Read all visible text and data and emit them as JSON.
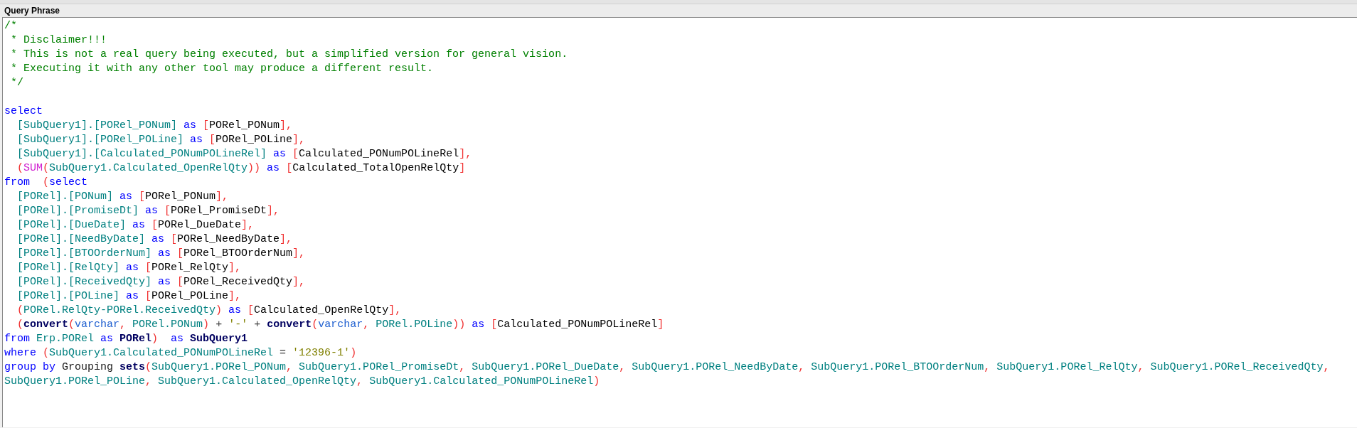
{
  "panel": {
    "title": "Query Phrase"
  },
  "comment_lines": [
    {
      "tokens": [
        {
          "kind": "comment",
          "text": "/*"
        }
      ]
    },
    {
      "tokens": [
        {
          "kind": "comment",
          "text": " * Disclaimer!!!"
        }
      ]
    },
    {
      "tokens": [
        {
          "kind": "comment",
          "text": " * This is not a real query being executed, but a simplified version for general vision."
        }
      ]
    },
    {
      "tokens": [
        {
          "kind": "comment",
          "text": " * Executing it with any other tool may produce a different result."
        }
      ]
    },
    {
      "tokens": [
        {
          "kind": "comment",
          "text": " */"
        }
      ]
    }
  ],
  "code_lines": [
    {
      "tokens": [
        {
          "kind": "keyword",
          "text": "select"
        }
      ]
    },
    {
      "tokens": [
        {
          "kind": "ident",
          "text": "  [SubQuery1].[PORel_PONum]"
        },
        {
          "kind": "keyword",
          "text": " as "
        },
        {
          "kind": "punct",
          "text": "["
        },
        {
          "kind": "alias",
          "text": "PORel_PONum"
        },
        {
          "kind": "punct",
          "text": "],"
        }
      ]
    },
    {
      "tokens": [
        {
          "kind": "ident",
          "text": "  [SubQuery1].[PORel_POLine]"
        },
        {
          "kind": "keyword",
          "text": " as "
        },
        {
          "kind": "punct",
          "text": "["
        },
        {
          "kind": "alias",
          "text": "PORel_POLine"
        },
        {
          "kind": "punct",
          "text": "],"
        }
      ]
    },
    {
      "tokens": [
        {
          "kind": "ident",
          "text": "  [SubQuery1].[Calculated_PONumPOLineRel]"
        },
        {
          "kind": "keyword",
          "text": " as "
        },
        {
          "kind": "punct",
          "text": "["
        },
        {
          "kind": "alias",
          "text": "Calculated_PONumPOLineRel"
        },
        {
          "kind": "punct",
          "text": "],"
        }
      ]
    },
    {
      "tokens": [
        {
          "kind": "punct",
          "text": "  ("
        },
        {
          "kind": "func",
          "text": "SUM"
        },
        {
          "kind": "punct",
          "text": "("
        },
        {
          "kind": "ident",
          "text": "SubQuery1.Calculated_OpenRelQty"
        },
        {
          "kind": "punct",
          "text": "))"
        },
        {
          "kind": "keyword",
          "text": " as "
        },
        {
          "kind": "punct",
          "text": "["
        },
        {
          "kind": "alias",
          "text": "Calculated_TotalOpenRelQty"
        },
        {
          "kind": "punct",
          "text": "]"
        }
      ]
    },
    {
      "tokens": [
        {
          "kind": "keyword",
          "text": "from"
        },
        {
          "kind": "punct",
          "text": "  ("
        },
        {
          "kind": "keyword",
          "text": "select"
        }
      ]
    },
    {
      "tokens": [
        {
          "kind": "ident",
          "text": "  [PORel].[PONum]"
        },
        {
          "kind": "keyword",
          "text": " as "
        },
        {
          "kind": "punct",
          "text": "["
        },
        {
          "kind": "alias",
          "text": "PORel_PONum"
        },
        {
          "kind": "punct",
          "text": "],"
        }
      ]
    },
    {
      "tokens": [
        {
          "kind": "ident",
          "text": "  [PORel].[PromiseDt]"
        },
        {
          "kind": "keyword",
          "text": " as "
        },
        {
          "kind": "punct",
          "text": "["
        },
        {
          "kind": "alias",
          "text": "PORel_PromiseDt"
        },
        {
          "kind": "punct",
          "text": "],"
        }
      ]
    },
    {
      "tokens": [
        {
          "kind": "ident",
          "text": "  [PORel].[DueDate]"
        },
        {
          "kind": "keyword",
          "text": " as "
        },
        {
          "kind": "punct",
          "text": "["
        },
        {
          "kind": "alias",
          "text": "PORel_DueDate"
        },
        {
          "kind": "punct",
          "text": "],"
        }
      ]
    },
    {
      "tokens": [
        {
          "kind": "ident",
          "text": "  [PORel].[NeedByDate]"
        },
        {
          "kind": "keyword",
          "text": " as "
        },
        {
          "kind": "punct",
          "text": "["
        },
        {
          "kind": "alias",
          "text": "PORel_NeedByDate"
        },
        {
          "kind": "punct",
          "text": "],"
        }
      ]
    },
    {
      "tokens": [
        {
          "kind": "ident",
          "text": "  [PORel].[BTOOrderNum]"
        },
        {
          "kind": "keyword",
          "text": " as "
        },
        {
          "kind": "punct",
          "text": "["
        },
        {
          "kind": "alias",
          "text": "PORel_BTOOrderNum"
        },
        {
          "kind": "punct",
          "text": "],"
        }
      ]
    },
    {
      "tokens": [
        {
          "kind": "ident",
          "text": "  [PORel].[RelQty]"
        },
        {
          "kind": "keyword",
          "text": " as "
        },
        {
          "kind": "punct",
          "text": "["
        },
        {
          "kind": "alias",
          "text": "PORel_RelQty"
        },
        {
          "kind": "punct",
          "text": "],"
        }
      ]
    },
    {
      "tokens": [
        {
          "kind": "ident",
          "text": "  [PORel].[ReceivedQty]"
        },
        {
          "kind": "keyword",
          "text": " as "
        },
        {
          "kind": "punct",
          "text": "["
        },
        {
          "kind": "alias",
          "text": "PORel_ReceivedQty"
        },
        {
          "kind": "punct",
          "text": "],"
        }
      ]
    },
    {
      "tokens": [
        {
          "kind": "ident",
          "text": "  [PORel].[POLine]"
        },
        {
          "kind": "keyword",
          "text": " as "
        },
        {
          "kind": "punct",
          "text": "["
        },
        {
          "kind": "alias",
          "text": "PORel_POLine"
        },
        {
          "kind": "punct",
          "text": "],"
        }
      ]
    },
    {
      "tokens": [
        {
          "kind": "punct",
          "text": "  ("
        },
        {
          "kind": "ident",
          "text": "PORel.RelQty-PORel.ReceivedQty"
        },
        {
          "kind": "punct",
          "text": ")"
        },
        {
          "kind": "keyword",
          "text": " as "
        },
        {
          "kind": "punct",
          "text": "["
        },
        {
          "kind": "alias",
          "text": "Calculated_OpenRelQty"
        },
        {
          "kind": "punct",
          "text": "],"
        }
      ]
    },
    {
      "tokens": [
        {
          "kind": "punct",
          "text": "  ("
        },
        {
          "kind": "name",
          "text": "convert"
        },
        {
          "kind": "punct",
          "text": "("
        },
        {
          "kind": "type",
          "text": "varchar"
        },
        {
          "kind": "punct",
          "text": ", "
        },
        {
          "kind": "ident",
          "text": "PORel.PONum"
        },
        {
          "kind": "punct",
          "text": ")"
        },
        {
          "kind": "op",
          "text": " + "
        },
        {
          "kind": "string",
          "text": "'-'"
        },
        {
          "kind": "op",
          "text": " + "
        },
        {
          "kind": "name",
          "text": "convert"
        },
        {
          "kind": "punct",
          "text": "("
        },
        {
          "kind": "type",
          "text": "varchar"
        },
        {
          "kind": "punct",
          "text": ", "
        },
        {
          "kind": "ident",
          "text": "PORel.POLine"
        },
        {
          "kind": "punct",
          "text": "))"
        },
        {
          "kind": "keyword",
          "text": " as "
        },
        {
          "kind": "punct",
          "text": "["
        },
        {
          "kind": "alias",
          "text": "Calculated_PONumPOLineRel"
        },
        {
          "kind": "punct",
          "text": "]"
        }
      ]
    },
    {
      "tokens": [
        {
          "kind": "keyword",
          "text": "from "
        },
        {
          "kind": "ident",
          "text": "Erp.PORel"
        },
        {
          "kind": "keyword",
          "text": " as "
        },
        {
          "kind": "name",
          "text": "PORel"
        },
        {
          "kind": "punct",
          "text": ")"
        },
        {
          "kind": "keyword",
          "text": "  as "
        },
        {
          "kind": "name",
          "text": "SubQuery1"
        }
      ]
    },
    {
      "tokens": [
        {
          "kind": "keyword",
          "text": "where "
        },
        {
          "kind": "punct",
          "text": "("
        },
        {
          "kind": "ident",
          "text": "SubQuery1.Calculated_PONumPOLineRel"
        },
        {
          "kind": "op",
          "text": " = "
        },
        {
          "kind": "string",
          "text": "'12396-1'"
        },
        {
          "kind": "punct",
          "text": ")"
        }
      ]
    },
    {
      "tokens": [
        {
          "kind": "keyword",
          "text": "group by "
        },
        {
          "kind": "plain",
          "text": "Grouping "
        },
        {
          "kind": "name",
          "text": "sets"
        },
        {
          "kind": "punct",
          "text": "("
        },
        {
          "kind": "ident",
          "text": "SubQuery1.PORel_PONum"
        },
        {
          "kind": "punct",
          "text": ", "
        },
        {
          "kind": "ident",
          "text": "SubQuery1.PORel_PromiseDt"
        },
        {
          "kind": "punct",
          "text": ", "
        },
        {
          "kind": "ident",
          "text": "SubQuery1.PORel_DueDate"
        },
        {
          "kind": "punct",
          "text": ", "
        },
        {
          "kind": "ident",
          "text": "SubQuery1.PORel_NeedByDate"
        },
        {
          "kind": "punct",
          "text": ", "
        },
        {
          "kind": "ident",
          "text": "SubQuery1.PORel_BTOOrderNum"
        },
        {
          "kind": "punct",
          "text": ", "
        },
        {
          "kind": "ident",
          "text": "SubQuery1.PORel_RelQty"
        },
        {
          "kind": "punct",
          "text": ", "
        },
        {
          "kind": "ident",
          "text": "SubQuery1.PORel_ReceivedQty"
        },
        {
          "kind": "punct",
          "text": ","
        }
      ]
    },
    {
      "tokens": [
        {
          "kind": "ident",
          "text": "SubQuery1.PORel_POLine"
        },
        {
          "kind": "punct",
          "text": ", "
        },
        {
          "kind": "ident",
          "text": "SubQuery1.Calculated_OpenRelQty"
        },
        {
          "kind": "punct",
          "text": ", "
        },
        {
          "kind": "ident",
          "text": "SubQuery1.Calculated_PONumPOLineRel"
        },
        {
          "kind": "punct",
          "text": ")"
        }
      ]
    }
  ]
}
